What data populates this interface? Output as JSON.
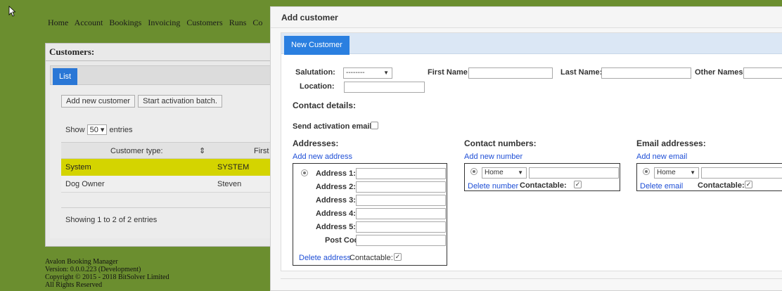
{
  "nav": {
    "items": [
      "Home",
      "Account",
      "Bookings",
      "Invoicing",
      "Customers",
      "Runs",
      "Co"
    ]
  },
  "customers_panel": {
    "title": "Customers:",
    "tab": "List",
    "add_button": "Add new customer",
    "batch_button": "Start activation batch.",
    "show_prefix": "Show",
    "show_value": "50",
    "show_suffix": "entries",
    "columns": [
      "Customer type:",
      "First"
    ],
    "rows": [
      {
        "type": "System",
        "first": "SYSTEM"
      },
      {
        "type": "Dog Owner",
        "first": "Steven"
      }
    ],
    "info": "Showing 1 to 2 of 2 entries"
  },
  "footer": {
    "line1": "Avalon Booking Manager",
    "line2": "Version: 0.0.0.223 (Development)",
    "line3": "Copyright © 2015 - 2018 BitSolver Limited",
    "line4": "All Rights Reserved"
  },
  "modal": {
    "title": "Add customer",
    "tab": "New Customer",
    "salutation_label": "Salutation:",
    "salutation_value": "--------",
    "first_name_label": "First Name:",
    "last_name_label": "Last Name:",
    "other_names_label": "Other Names:",
    "location_label": "Location:",
    "contact_details": "Contact details:",
    "send_activation_label": "Send activation email:",
    "addresses": {
      "heading": "Addresses:",
      "add_link": "Add new address",
      "labels": [
        "Address 1:",
        "Address 2:",
        "Address 3:",
        "Address 4:",
        "Address 5:",
        "Post Code:"
      ],
      "delete_link": "Delete address",
      "contactable_label": "Contactable:"
    },
    "numbers": {
      "heading": "Contact numbers:",
      "add_link": "Add new number",
      "type_value": "Home",
      "delete_link": "Delete number",
      "contactable_label": "Contactable:"
    },
    "emails": {
      "heading": "Email addresses:",
      "add_link": "Add new email",
      "type_value": "Home",
      "delete_link": "Delete email",
      "contactable_label": "Contactable:"
    }
  },
  "colors": {
    "page_bg": "#6b8e2f",
    "tab_blue": "#2a7fe0",
    "selected_row": "#d4d400",
    "link_blue": "#1f4fd6"
  }
}
